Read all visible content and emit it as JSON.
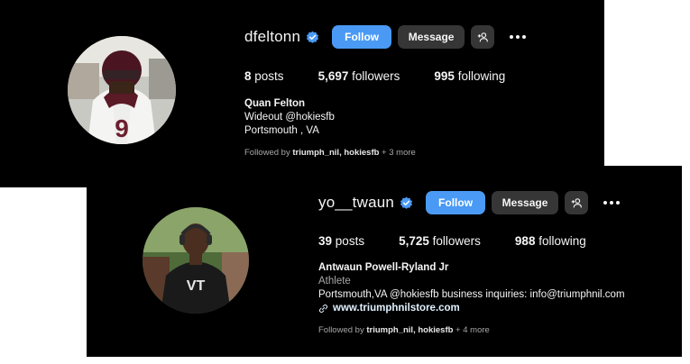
{
  "buttons": {
    "follow": "Follow",
    "message": "Message"
  },
  "icons": {
    "verified": "verified-badge-icon",
    "add_user": "add-user-icon",
    "more": "more-options-icon",
    "link": "link-icon"
  },
  "colors": {
    "follow_blue": "#4a9af5",
    "verified_blue": "#4a9af5",
    "button_gray": "#363636",
    "muted_text": "#a8a8a8"
  },
  "profiles": [
    {
      "username": "dfeltonn",
      "stats": {
        "posts": "8",
        "posts_label": "posts",
        "followers": "5,697",
        "followers_label": "followers",
        "following": "995",
        "following_label": "following"
      },
      "bio": {
        "name": "Quan Felton",
        "line1": "Wideout @hokiesfb",
        "line2": "Portsmouth , VA"
      },
      "followed_by": {
        "prefix": "Followed by ",
        "names": "triumph_nil, hokiesfb",
        "suffix": " + 3 more"
      }
    },
    {
      "username": "yo__twaun",
      "stats": {
        "posts": "39",
        "posts_label": "posts",
        "followers": "5,725",
        "followers_label": "followers",
        "following": "988",
        "following_label": "following"
      },
      "bio": {
        "name": "Antwaun Powell-Ryland Jr",
        "category": "Athlete",
        "line1": "Portsmouth,VA @hokiesfb business inquiries: info@triumphnil.com",
        "link": "www.triumphnilstore.com"
      },
      "followed_by": {
        "prefix": "Followed by ",
        "names": "triumph_nil, hokiesfb",
        "suffix": " + 4 more"
      }
    }
  ]
}
